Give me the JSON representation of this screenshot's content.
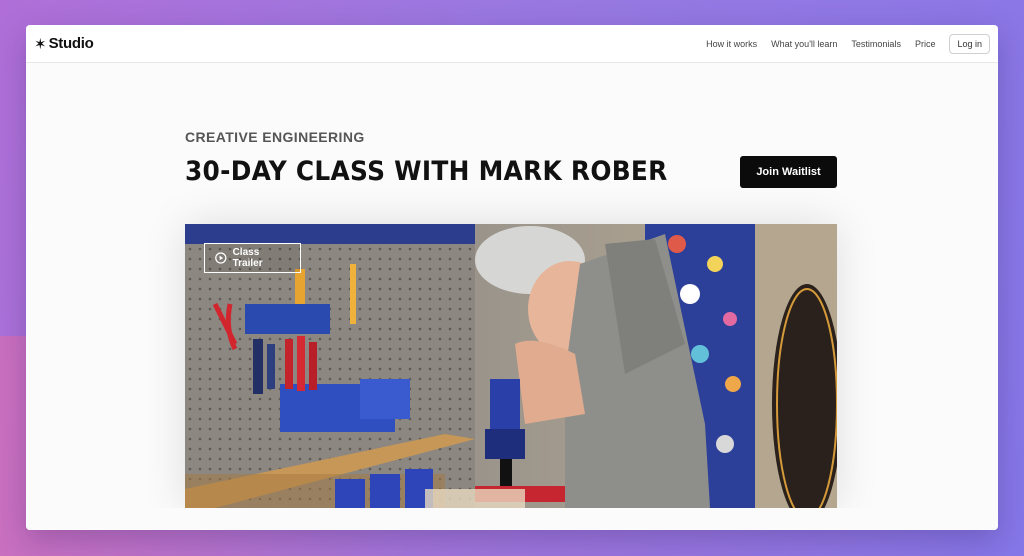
{
  "brand": {
    "name": "Studio",
    "icon": "star-icon"
  },
  "nav": {
    "links": [
      "How it works",
      "What you'll learn",
      "Testimonials",
      "Price"
    ],
    "login": "Log in"
  },
  "hero": {
    "kicker": "CREATIVE ENGINEERING",
    "title": "30-DAY CLASS WITH MARK ROBER",
    "cta": "Join Waitlist"
  },
  "video": {
    "trailer_label": "Class Trailer",
    "play_icon": "play-circle-icon"
  },
  "colors": {
    "accent": "#0b0b0b",
    "background_gradient_start": "#b06fd8",
    "background_gradient_end": "#8577e8"
  }
}
